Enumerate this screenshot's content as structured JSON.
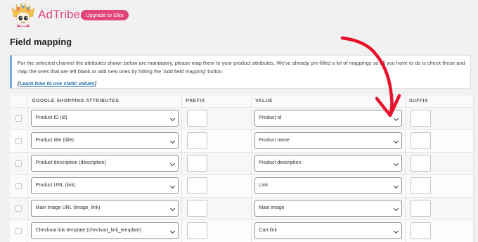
{
  "header": {
    "brand": "AdTribes",
    "upgrade_label": "Upgrade to Elite"
  },
  "page": {
    "title": "Field mapping"
  },
  "notice": {
    "text": "For the selected channel the attributes shown below are mandatory, please map them to your product attributes. We've already pre-filled a lot of mappings so all you have to do is check those and map the ones that are left blank or add new ones by hitting the 'Add field mapping' button.",
    "link_label": "Learn how to use static values"
  },
  "table": {
    "columns": [
      "",
      "GOOGLE SHOPPING ATTRIBUTES",
      "PREFIX",
      "VALUE",
      "SUFFIX"
    ],
    "rows": [
      {
        "attribute": "Product ID (id)",
        "value": "Product Id"
      },
      {
        "attribute": "Product title (title)",
        "value": "Product name"
      },
      {
        "attribute": "Product description (description)",
        "value": "Product description"
      },
      {
        "attribute": "Product URL (link)",
        "value": "Link"
      },
      {
        "attribute": "Main image URL (image_link)",
        "value": "Main image"
      },
      {
        "attribute": "Checkout link template (checkout_link_template)",
        "value": "Cart link"
      }
    ]
  },
  "colors": {
    "brand": "#e0457b",
    "annotation_arrow": "#e8102a",
    "notice_accent": "#72aee6"
  }
}
